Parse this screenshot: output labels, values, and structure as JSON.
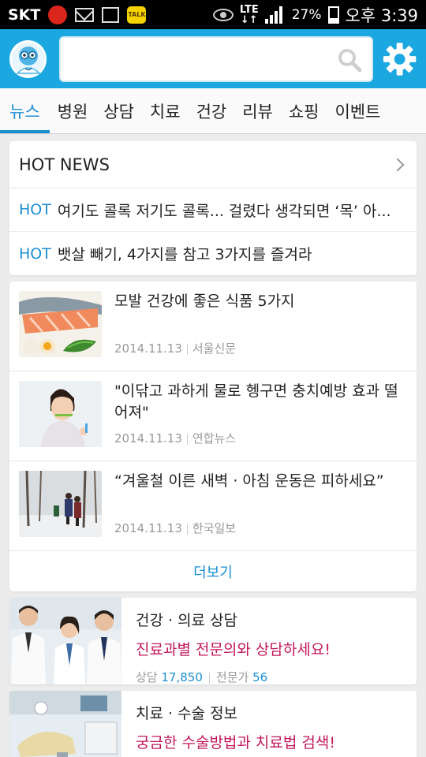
{
  "status_bar": {
    "carrier": "SKT",
    "network": "LTE",
    "battery": "27%",
    "time": "오후 3:39",
    "notification_icons": [
      "app-red-badge-icon",
      "mail-icon",
      "image-icon",
      "kakaotalk-icon"
    ],
    "kakaotalk_label": "TALK"
  },
  "header": {
    "search_value": "",
    "search_placeholder": "",
    "accent_color": "#1ba7e0"
  },
  "tabs": [
    {
      "label": "뉴스",
      "active": true
    },
    {
      "label": "병원",
      "active": false
    },
    {
      "label": "상담",
      "active": false
    },
    {
      "label": "치료",
      "active": false
    },
    {
      "label": "건강",
      "active": false
    },
    {
      "label": "리뷰",
      "active": false
    },
    {
      "label": "쇼핑",
      "active": false
    },
    {
      "label": "이벤트",
      "active": false
    }
  ],
  "hot_news": {
    "title": "HOT NEWS",
    "items": [
      {
        "tag": "HOT",
        "text": "여기도 콜록 저기도 콜록... 걸렸다 생각되면 ‘목’ 아..."
      },
      {
        "tag": "HOT",
        "text": "뱃살 빼기, 4가지를 참고 3가지를 즐겨라"
      }
    ]
  },
  "news": {
    "items": [
      {
        "title": "모발 건강에 좋은 식품 5가지",
        "date": "2014.11.13",
        "source": "서울신문",
        "image": "salmon-egg-spinach-photo"
      },
      {
        "title": "\"이닦고 과하게 물로 헹구면 충치예방 효과 떨어져\"",
        "date": "2014.11.13",
        "source": "연합뉴스",
        "image": "child-brushing-teeth-photo"
      },
      {
        "title": "“겨울철 이른 새벽 · 아침 운동은 피하세요”",
        "date": "2014.11.13",
        "source": "한국일보",
        "image": "snowy-forest-hikers-photo"
      }
    ],
    "more_label": "더보기"
  },
  "services": [
    {
      "title": "건강 · 의료 상담",
      "desc": "진료과별 전문의와 상담하세요!",
      "stat1_label": "상담",
      "stat1_value": "17,850",
      "stat2_label": "전문가",
      "stat2_value": "56",
      "image": "doctors-photo"
    },
    {
      "title": "치료 · 수술 정보",
      "desc": "궁금한 수술방법과 치료법 검색!",
      "image": "dental-clinic-photo"
    }
  ]
}
